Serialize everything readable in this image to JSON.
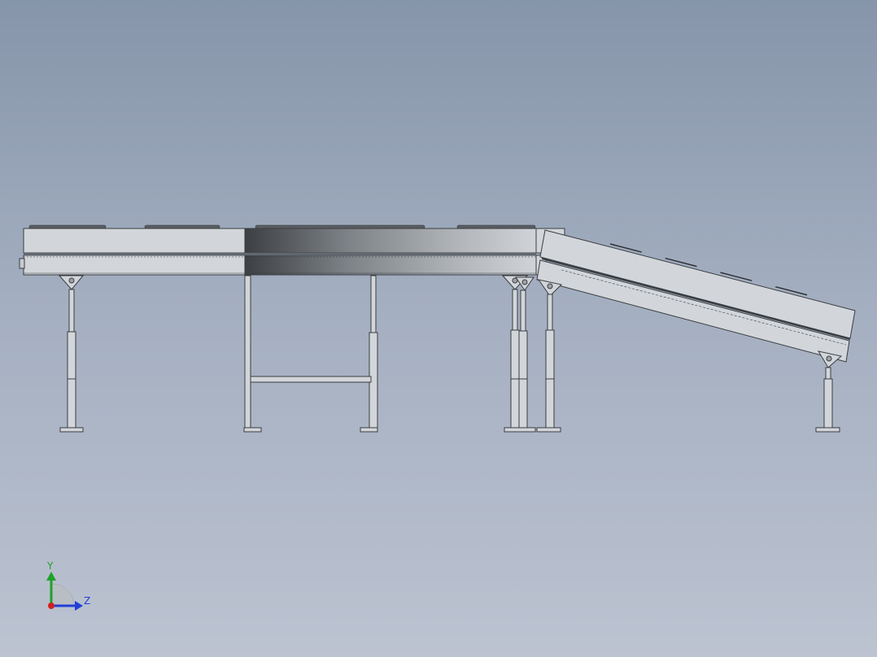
{
  "view": {
    "background_top": "#8695aa",
    "background_bottom": "#bcc3d1",
    "part_fill": "#d2d6da",
    "edge_color": "#3a3d40"
  },
  "triad": {
    "y_label": "Y",
    "z_label": "Z",
    "y_color": "#1fa12a",
    "z_color": "#1f3fd6",
    "x_color": "#d21f1f"
  }
}
